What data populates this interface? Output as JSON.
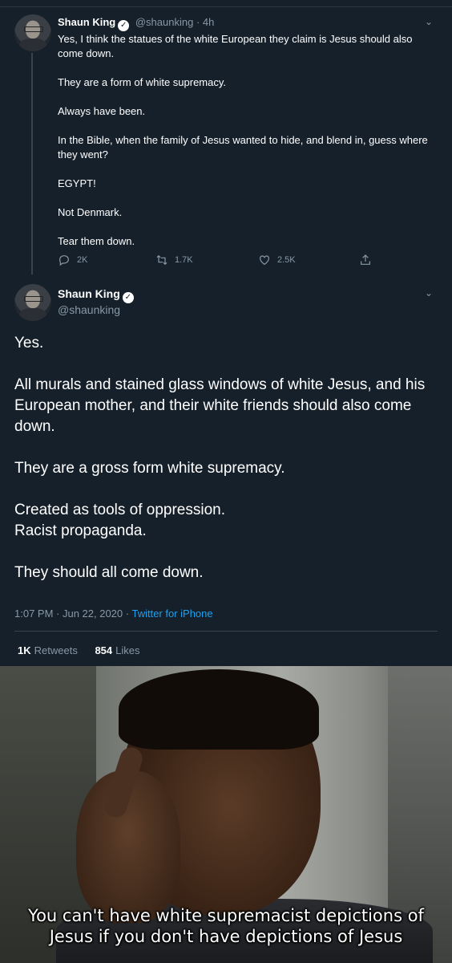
{
  "tweet1": {
    "name": "Shaun King",
    "handle": "@shaunking",
    "time": "4h",
    "lines": [
      "Yes, I think the statues of the white European they claim is Jesus should also come down.",
      "They are a form of white supremacy.",
      "Always have been.",
      "In the Bible, when the family of Jesus wanted to hide, and blend in, guess where they went?",
      "EGYPT!",
      "Not Denmark.",
      "Tear them down."
    ],
    "replies": "2K",
    "retweets": "1.7K",
    "likes": "2.5K",
    "icons": [
      "reply-icon",
      "retweet-icon",
      "like-icon",
      "share-icon"
    ]
  },
  "tweet2": {
    "name": "Shaun King",
    "handle": "@shaunking",
    "lines": [
      "Yes.",
      "All murals and stained glass windows of white Jesus, and his European mother, and their white friends should also come down.",
      "They are a gross form white supremacy.",
      "Created as tools of oppression.",
      "Racist propaganda.",
      "They should all come down."
    ],
    "timestamp": "1:07 PM · Jun 22, 2020 · ",
    "source": "Twitter for iPhone",
    "retweets_count": "1K",
    "retweets_label": "Retweets",
    "likes_count": "854",
    "likes_label": "Likes"
  },
  "meme": {
    "caption_line1": "You can't have white supremacist depictions of",
    "caption_line2": "Jesus if you don't have depictions of Jesus"
  },
  "colors": {
    "background": "#15202b",
    "muted": "#8899a6",
    "link": "#1da1f2",
    "divider": "#38444d"
  }
}
